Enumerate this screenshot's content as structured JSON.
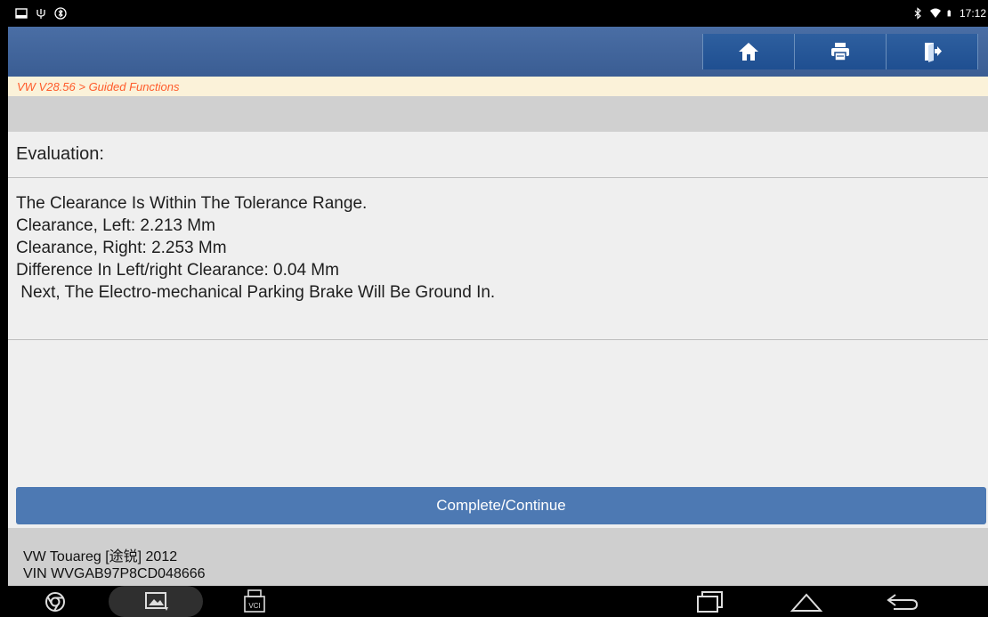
{
  "breadcrumb": "VW V28.56 > Guided Functions",
  "status": {
    "time": "17:12"
  },
  "icons": {
    "home": "home-icon",
    "print": "printer-icon",
    "exit": "exit-icon",
    "chrome": "chrome-icon",
    "gallery": "gallery-download-icon",
    "vci": "vci-icon",
    "recent": "recent-apps-icon",
    "navhome": "home-nav-icon",
    "back": "back-icon"
  },
  "main": {
    "evaluation_label": "Evaluation:",
    "message_lines": [
      "The Clearance Is Within The Tolerance Range.",
      "Clearance, Left: 2.213 Mm",
      "Clearance, Right: 2.253 Mm",
      "Difference In Left/right Clearance: 0.04 Mm",
      " Next, The Electro-mechanical Parking Brake Will Be Ground In."
    ]
  },
  "action": {
    "label": "Complete/Continue"
  },
  "vehicle": {
    "model": "VW Touareg [途锐] 2012",
    "vin": "VIN WVGAB97P8CD048666"
  },
  "nav": {
    "vci_label": "VCI"
  },
  "colors": {
    "header": "#3a5d93",
    "header_button": "#1f4f91",
    "breadcrumb_bg": "#fbf2d9",
    "breadcrumb_text": "#ff5a2a",
    "action_button": "#4d79b3"
  }
}
